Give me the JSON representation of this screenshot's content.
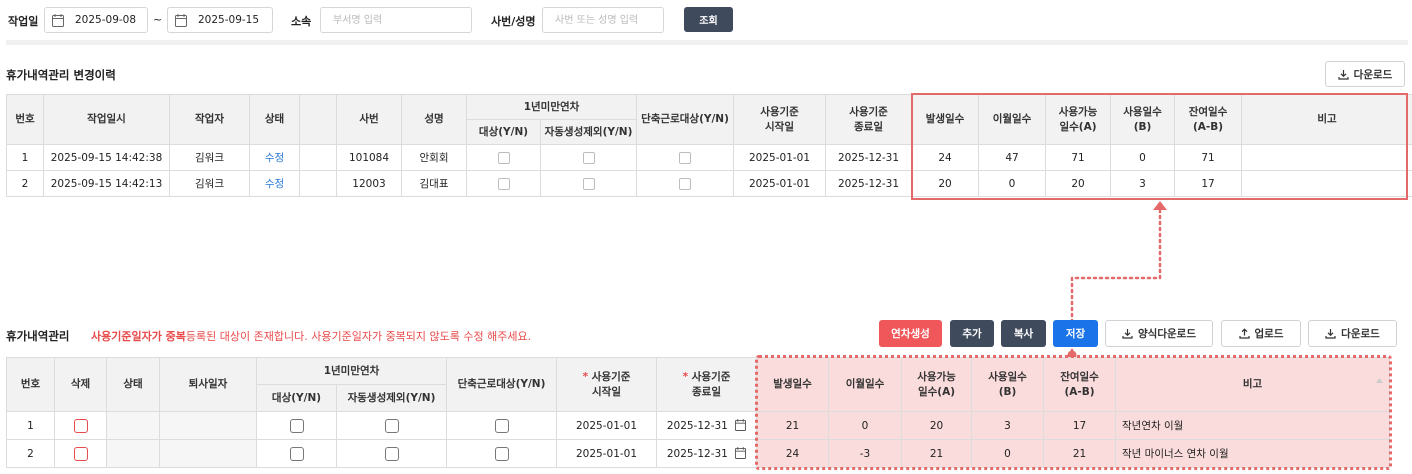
{
  "search": {
    "work_date_label": "작업일",
    "date_from": "2025-09-08",
    "date_sep": "~",
    "date_to": "2025-09-15",
    "dept_label": "소속",
    "dept_placeholder": "부서명 입력",
    "emp_label": "사번/성명",
    "emp_placeholder": "사번 또는 성명 입력",
    "search_button": "조회"
  },
  "history": {
    "title": "휴가내역관리 변경이력",
    "download_label": "다운로드",
    "headers": {
      "no": "번호",
      "work_datetime": "작업일시",
      "worker": "작업자",
      "status": "상태",
      "blank": "",
      "emp_no": "사번",
      "name": "성명",
      "under_one_year": "1년미만연차",
      "target": "대상(Y/N)",
      "auto_exclude": "자동생성제외(Y/N)",
      "short_work": "단축근로대상(Y/N)",
      "start_l1": "사용기준",
      "start_l2": "시작일",
      "end_l1": "사용기준",
      "end_l2": "종료일",
      "occurred": "발생일수",
      "carried": "이월일수",
      "avail_l1": "사용가능",
      "avail_l2": "일수(A)",
      "used_l1": "사용일수",
      "used_l2": "(B)",
      "remain_l1": "잔여일수",
      "remain_l2": "(A-B)",
      "note": "비고"
    },
    "rows": [
      {
        "no": "1",
        "work_datetime": "2025-09-15 14:42:38",
        "worker": "김워크",
        "status": "수정",
        "emp_no": "101084",
        "name": "안회회",
        "start": "2025-01-01",
        "end": "2025-12-31",
        "occurred": "24",
        "carried": "47",
        "available": "71",
        "used": "0",
        "remaining": "71",
        "note": ""
      },
      {
        "no": "2",
        "work_datetime": "2025-09-15 14:42:13",
        "worker": "김워크",
        "status": "수정",
        "emp_no": "12003",
        "name": "김대표",
        "start": "2025-01-01",
        "end": "2025-12-31",
        "occurred": "20",
        "carried": "0",
        "available": "20",
        "used": "3",
        "remaining": "17",
        "note": ""
      }
    ]
  },
  "manage": {
    "title": "휴가내역관리",
    "warning_bold": "사용기준일자가 중복",
    "warning_rest": "등록된 대상이 존재합니다. 사용기준일자가 중복되지 않도록 수정 해주세요.",
    "buttons": {
      "generate": "연차생성",
      "add": "추가",
      "copy": "복사",
      "save": "저장",
      "template_download": "양식다운로드",
      "upload": "업로드",
      "download": "다운로드"
    },
    "headers": {
      "no": "번호",
      "delete": "삭제",
      "status": "상태",
      "retire_date": "퇴사일자",
      "under_one_year": "1년미만연차",
      "target": "대상(Y/N)",
      "auto_exclude": "자동생성제외(Y/N)",
      "short_work": "단축근로대상(Y/N)",
      "req_mark": "*",
      "start_l1": "사용기준",
      "start_l2": "시작일",
      "end_l1": "사용기준",
      "end_l2": "종료일",
      "occurred": "발생일수",
      "carried": "이월일수",
      "avail_l1": "사용가능",
      "avail_l2": "일수(A)",
      "used_l1": "사용일수",
      "used_l2": "(B)",
      "remain_l1": "잔여일수",
      "remain_l2": "(A-B)",
      "note": "비고"
    },
    "rows": [
      {
        "no": "1",
        "start": "2025-01-01",
        "end": "2025-12-31",
        "occurred": "21",
        "carried": "0",
        "available": "20",
        "used": "3",
        "remaining": "17",
        "note": "작년연차 이월"
      },
      {
        "no": "2",
        "start": "2025-01-01",
        "end": "2025-12-31",
        "occurred": "24",
        "carried": "-3",
        "available": "21",
        "used": "0",
        "remaining": "21",
        "note": "작년 마이너스 연차 이월"
      }
    ]
  },
  "colors": {
    "highlight": "#e46a6a",
    "pink_fill": "#fbdcdc",
    "search_button": "#3f4a5c",
    "generate_button": "#f0575a",
    "dark_button": "#3f4a5c",
    "save_button": "#1a73e8",
    "link": "#2a7ad6",
    "warning": "#e94a4a"
  },
  "icons": [
    "calendar-icon",
    "download-icon",
    "upload-icon",
    "sort-icon"
  ]
}
